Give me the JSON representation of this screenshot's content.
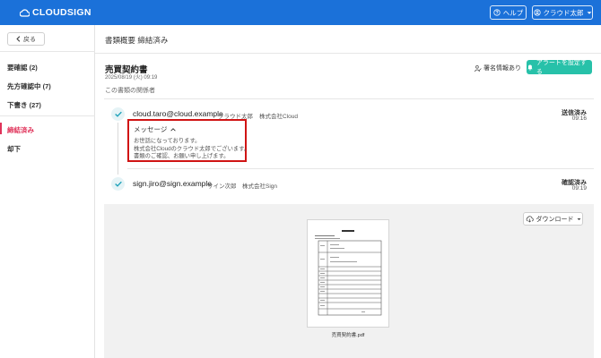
{
  "header": {
    "logo_text": "CLOUDSIGN",
    "help_label": "ヘルプ",
    "user_label": "クラウド太郎",
    "brand_color": "#1b71d9"
  },
  "sidebar": {
    "back_label": "戻る",
    "items": [
      {
        "label": "要確認 (2)"
      },
      {
        "label": "先方確認中 (7)"
      },
      {
        "label": "下書き (27)"
      },
      {
        "label": "締結済み"
      },
      {
        "label": "却下"
      }
    ],
    "active_color": "#e0335a"
  },
  "main": {
    "page_title": "書類概要 締結済み",
    "document": {
      "title": "売買契約書",
      "date": "2025/08/19 (火) 09:19"
    },
    "signature_info_label": "署名情報あり",
    "alert_button_label": "アラートを設定する",
    "parties_label": "この書類の関係者",
    "parties": [
      {
        "email": "cloud.taro@cloud.example",
        "name": "クラウド太郎",
        "company": "株式会社Cloud",
        "status": "送信済み",
        "time": "09:16"
      },
      {
        "email": "sign.jiro@sign.example",
        "name": "サイン次郎",
        "company": "株式会社Sign",
        "status": "確認済み",
        "time": "09:19"
      }
    ],
    "message": {
      "toggle_label": "メッセージ",
      "lines": [
        "お世話になっております。",
        "株式会社Cloudのクラウド太郎でございます。",
        "書類のご確認、お願い申し上げます。"
      ]
    },
    "download_label": "ダウンロード",
    "file_name": "売買契約書.pdf"
  }
}
